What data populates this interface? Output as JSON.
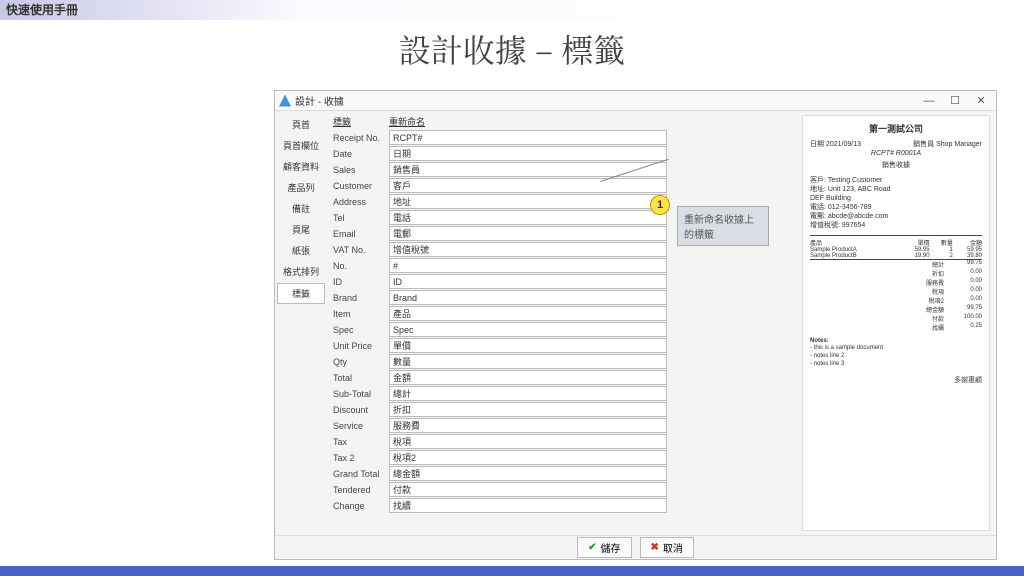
{
  "topbar": "快速使用手冊",
  "page_title": "設計收據 – 標籤",
  "window": {
    "title": "設計 - 收據"
  },
  "sidebar": [
    "頁首",
    "頁首欄位",
    "顧客資料",
    "產品列",
    "備註",
    "頁尾",
    "紙張",
    "格式排列",
    "標籤"
  ],
  "sidebar_selected": 8,
  "form_header": {
    "col1": "標籤",
    "col2": "重新命名"
  },
  "fields": [
    {
      "label": "Receipt No.",
      "value": "RCPT#"
    },
    {
      "label": "Date",
      "value": "日期"
    },
    {
      "label": "Sales",
      "value": "銷售員"
    },
    {
      "label": "Customer",
      "value": "客戶"
    },
    {
      "label": "Address",
      "value": "地址"
    },
    {
      "label": "Tel",
      "value": "電話"
    },
    {
      "label": "Email",
      "value": "電郵"
    },
    {
      "label": "VAT No.",
      "value": "增值稅號"
    },
    {
      "label": "No.",
      "value": "#"
    },
    {
      "label": "ID",
      "value": "ID"
    },
    {
      "label": "Brand",
      "value": "Brand"
    },
    {
      "label": "Item",
      "value": "產品"
    },
    {
      "label": "Spec",
      "value": "Spec"
    },
    {
      "label": "Unit Price",
      "value": "單價"
    },
    {
      "label": "Qty",
      "value": "數量"
    },
    {
      "label": "Total",
      "value": "金額"
    },
    {
      "label": "Sub-Total",
      "value": "總計"
    },
    {
      "label": "Discount",
      "value": "折扣"
    },
    {
      "label": "Service",
      "value": "服務費"
    },
    {
      "label": "Tax",
      "value": "稅項"
    },
    {
      "label": "Tax 2",
      "value": "稅項2"
    },
    {
      "label": "Grand Total",
      "value": "總金額"
    },
    {
      "label": "Tendered",
      "value": "付款"
    },
    {
      "label": "Change",
      "value": "找續"
    }
  ],
  "callout": {
    "num": "1",
    "text": "重新命名收據上的標籤"
  },
  "footer": {
    "save": "儲存",
    "cancel": "取消"
  },
  "preview": {
    "company": "第一測試公司",
    "date_label": "日期",
    "date": "2021/09/13",
    "sales_label": "銷售員",
    "sales": "Shop Manager",
    "rcpt": "RCPT# R0001A",
    "doc_title": "銷售收據",
    "cust_label": "客戶:",
    "cust_name": "Testing Customer",
    "addr_label": "地址:",
    "addr1": "Unit 123, ABC Road",
    "addr2": "DEF Building",
    "tel_label": "電話:",
    "tel": "012-3456-789",
    "email_label": "電郵:",
    "email": "abcde@abcde.com",
    "vat_label": "增值稅號:",
    "vat": "997654",
    "th": {
      "item": "產品",
      "price": "單價",
      "qty": "數量",
      "amt": "金額"
    },
    "lines": [
      {
        "item": "Sample ProductA",
        "price": "59.95",
        "qty": "1",
        "amt": "59.95"
      },
      {
        "item": "Sample ProductB",
        "price": "19.90",
        "qty": "2",
        "amt": "39.80"
      }
    ],
    "sums": [
      {
        "l": "總計",
        "v": "99.75"
      },
      {
        "l": "折扣",
        "v": "0.00"
      },
      {
        "l": "服務費",
        "v": "0.00"
      },
      {
        "l": "稅項",
        "v": "0.00"
      },
      {
        "l": "稅項2",
        "v": "0.00"
      },
      {
        "l": "總金額",
        "v": "99.75"
      },
      {
        "l": "付款",
        "v": "100.00"
      },
      {
        "l": "找續",
        "v": "0.25"
      }
    ],
    "notes_h": "Notes:",
    "notes": [
      "- this is a sample document",
      "- notes line 2",
      "- notes line 3"
    ],
    "thanks": "多謝惠顧"
  }
}
